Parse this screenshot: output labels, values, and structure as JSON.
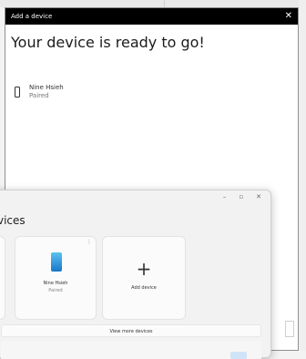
{
  "dialog": {
    "title": "Add a device",
    "close_glyph": "✕",
    "heading": "Your device is ready to go!",
    "device": {
      "name": "Nine Hsieh",
      "status": "Paired",
      "icon": "phone-icon"
    }
  },
  "settings": {
    "window_controls": {
      "minimize": "–",
      "maximize": "▫",
      "close": "✕"
    },
    "title": "vices",
    "devices": [
      {
        "name": "Nine Hsieh",
        "status": "Paired",
        "more": "⋮"
      }
    ],
    "left_card_more": "⋮",
    "add_device": {
      "icon": "+",
      "label": "Add device"
    },
    "view_more": "View more devices"
  },
  "colors": {
    "titlebar": "#000000",
    "phone_gradient_top": "#5bc2f0",
    "phone_gradient_bottom": "#1877c9"
  }
}
